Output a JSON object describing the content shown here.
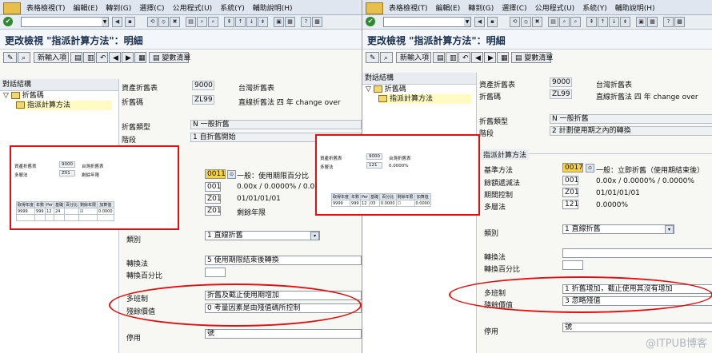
{
  "left": {
    "menu": [
      "表格檢視(T)",
      "編輯(E)",
      "轉到(G)",
      "選擇(C)",
      "公用程式(U)",
      "系統(Y)",
      "輔助說明(H)"
    ],
    "title": "更改檢視 \"指派計算方法\"：明細",
    "toolbar": {
      "new_entries": "新輸入項",
      "variable_list": "變數清單"
    },
    "tree": {
      "header": "對話結構",
      "item1": "折舊碼",
      "item2": "指派計算方法"
    },
    "fields": {
      "chart_label": "資產折舊表",
      "chart_value": "9000",
      "chart_text": "台灣折舊表",
      "depkey_label": "折舊碼",
      "depkey_value": "ZL99",
      "depkey_text": "直線折舊法 四 年 change over",
      "deptype_label": "折舊類型",
      "deptype_value": "N 一般折舊",
      "phase_label": "階段",
      "phase_value": "1 自折舊開始"
    },
    "calc": {
      "base_value": "0011",
      "base_text": "一般：使用期限百分比",
      "declining_value": "001",
      "declining_text": "0.00x / 0.0000% / 0.000",
      "period_value": "Z01",
      "period_text": "01/01/01/01",
      "multi_value": "Z01",
      "multi_text": "剩餘年限"
    },
    "class_label": "類別",
    "class_value": "1 直線折舊",
    "conv_label": "轉換法",
    "conv_value": "5 使用期限結束後轉換",
    "convpct_label": "轉換百分比",
    "multishift_label": "多班制",
    "multishift_value": "折舊及截止使用期增加",
    "scrap_label": "殘餘價值",
    "scrap_value": "0 考量因素是由殘值碼所控制",
    "shutdown_label": "停用",
    "shutdown_value": "號",
    "overlay": {
      "chart_label": "資產折舊表",
      "chart_value": "9000",
      "chart_text": "台灣折舊表",
      "multi_label": "多層法",
      "multi_value": "Z01",
      "multi_text": "剩餘年限",
      "headers": [
        "取得年度",
        "年數",
        "Per",
        "基礎",
        "百分比",
        "剩餘年限",
        "加算值"
      ],
      "row": [
        "9999",
        "999",
        "12",
        "24",
        "",
        "",
        "0.0000"
      ]
    }
  },
  "right": {
    "menu": [
      "表格檢視(T)",
      "編輯(E)",
      "轉到(G)",
      "選擇(C)",
      "公用程式(U)",
      "系統(Y)",
      "輔助說明(H)"
    ],
    "title": "更改檢視 \"指派計算方法\"：明細",
    "toolbar": {
      "new_entries": "新輸入項",
      "variable_list": "變數清單"
    },
    "tree": {
      "header": "對話結構",
      "item1": "折舊碼",
      "item2": "指派計算方法"
    },
    "fields": {
      "chart_label": "資產折舊表",
      "chart_value": "9000",
      "chart_text": "台灣折舊表",
      "depkey_label": "折舊碼",
      "depkey_value": "ZL99",
      "depkey_text": "直線折舊法 四 年 change over",
      "deptype_label": "折舊類型",
      "deptype_value": "N 一般折舊",
      "phase_label": "階段",
      "phase_value": "2 計劃使用期之內的轉換"
    },
    "calc": {
      "group_title": "指派計算方法",
      "base_label": "基準方法",
      "base_value": "0017",
      "base_text": "一般：立即折舊（使用期結束後）",
      "declining_label": "餘額遞減法",
      "declining_value": "001",
      "declining_text": "0.00x / 0.0000% / 0.0000%",
      "period_label": "期間控制",
      "period_value": "Z01",
      "period_text": "01/01/01/01",
      "multi_label": "多層法",
      "multi_value": "121",
      "multi_text": "0.0000%"
    },
    "class_label": "類別",
    "class_value": "1 直線折舊",
    "conv_label": "轉換法",
    "convpct_label": "轉換百分比",
    "multishift_label": "多班制",
    "multishift_value": "1 折舊增加，截止使用其沒有增加",
    "scrap_label": "殘餘價值",
    "scrap_value": "3 忽略殘值",
    "shutdown_label": "停用",
    "shutdown_value": "號",
    "overlay": {
      "chart_label": "資產折舊表",
      "chart_value": "9000",
      "chart_text": "台灣折舊表",
      "multi_label": "多層法",
      "multi_value": "121",
      "multi_text": "0.0000%",
      "headers": [
        "取得年度",
        "年數",
        "Per",
        "基礎",
        "百分比",
        "剩餘年限",
        "加算值"
      ],
      "row": [
        "9999",
        "999",
        "12",
        "03",
        "0.0000",
        "",
        "0.0000"
      ]
    }
  },
  "watermark": "@ITPUB博客",
  "colors": {
    "highlight": "#fcd23a",
    "annotation": "#e01010",
    "title": "#18304e"
  }
}
